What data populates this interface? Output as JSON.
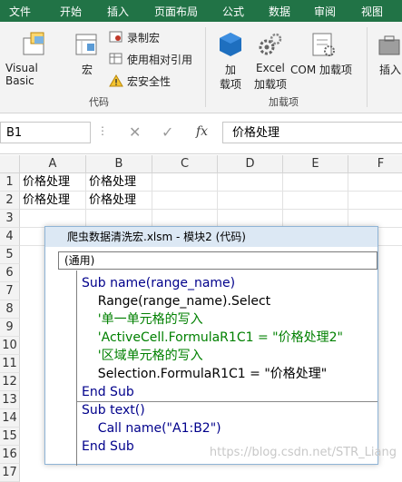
{
  "ribbon_tabs": [
    "文件",
    "开始",
    "插入",
    "页面布局",
    "公式",
    "数据",
    "审阅",
    "视图"
  ],
  "ribbon": {
    "visual_basic": "Visual Basic",
    "macro": "宏",
    "record_macro": "录制宏",
    "relative_ref": "使用相对引用",
    "macro_security": "宏安全性",
    "code_group": "代码",
    "addin_line1": "加",
    "addin_line2": "载项",
    "excel_addin_line1": "Excel",
    "excel_addin_line2": "加载项",
    "com_addin": "COM 加载项",
    "addins_group": "加载项",
    "insert": "插入"
  },
  "formula_bar": {
    "name_box": "B1",
    "fx": "fx",
    "value": "价格处理"
  },
  "columns": [
    "A",
    "B",
    "C",
    "D",
    "E",
    "F"
  ],
  "rows": [
    "1",
    "2",
    "3",
    "4",
    "5",
    "6",
    "7",
    "8",
    "9",
    "10",
    "11",
    "12",
    "13",
    "14",
    "15",
    "16",
    "17"
  ],
  "cells": {
    "A1": "价格处理",
    "B1": "价格处理",
    "A2": "价格处理",
    "B2": "价格处理"
  },
  "vba": {
    "title": "爬虫数据清洗宏.xlsm - 模块2 (代码)",
    "scope": "(通用)",
    "lines": [
      "Sub name(range_name)",
      "    Range(range_name).Select",
      "    '单一单元格的写入",
      "    'ActiveCell.FormulaR1C1 = \"价格处理2\"",
      "    '区域单元格的写入",
      "    Selection.FormulaR1C1 = \"价格处理\"",
      "End Sub",
      "Sub text()",
      "    Call name(\"A1:B2\")",
      "End Sub"
    ]
  },
  "watermark": "https://blog.csdn.net/STR_Liang",
  "colors": {
    "ribbon_green": "#217346",
    "keyword_blue": "#00008b",
    "comment_green": "#008000"
  }
}
